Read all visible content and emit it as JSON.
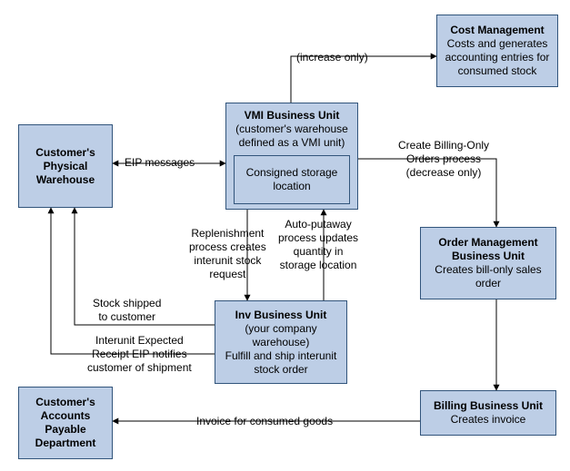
{
  "boxes": {
    "customer_warehouse": {
      "title": "Customer's Physical Warehouse"
    },
    "vmi_bu": {
      "title": "VMI Business Unit",
      "subtitle": "(customer's warehouse defined as a VMI unit)",
      "inner": "Consigned storage location"
    },
    "cost_mgmt": {
      "title": "Cost Management",
      "subtitle": "Costs and generates accounting entries for consumed stock"
    },
    "order_mgmt": {
      "title": "Order Management Business Unit",
      "subtitle": "Creates bill-only sales order"
    },
    "inv_bu": {
      "title": "Inv Business Unit",
      "subtitle1": "(your company warehouse)",
      "subtitle2": "Fulfill and ship interunit stock order"
    },
    "billing_bu": {
      "title": "Billing Business Unit",
      "subtitle": "Creates invoice"
    },
    "ap_dept": {
      "title": "Customer's Accounts Payable Department"
    }
  },
  "labels": {
    "eip_messages": "EIP messages",
    "increase_only": "(increase only)",
    "create_billing_l1": "Create Billing-Only",
    "create_billing_l2": "Orders process",
    "create_billing_l3": "(decrease only)",
    "replenishment_l1": "Replenishment",
    "replenishment_l2": "process creates",
    "replenishment_l3": "interunit stock",
    "replenishment_l4": "request",
    "autoputaway_l1": "Auto-putaway",
    "autoputaway_l2": "process updates",
    "autoputaway_l3": "quantity in",
    "autoputaway_l4": "storage location",
    "stock_shipped_l1": "Stock shipped",
    "stock_shipped_l2": "to customer",
    "interunit_eip_l1": "Interunit Expected",
    "interunit_eip_l2": "Receipt EIP notifies",
    "interunit_eip_l3": "customer of shipment",
    "invoice": "Invoice for consumed goods"
  },
  "chart_data": {
    "type": "flow-diagram",
    "nodes": [
      {
        "id": "customer_warehouse",
        "title": "Customer's Physical Warehouse"
      },
      {
        "id": "vmi_bu",
        "title": "VMI Business Unit",
        "subtitle": "(customer's warehouse defined as a VMI unit)",
        "inner": "Consigned storage location"
      },
      {
        "id": "cost_mgmt",
        "title": "Cost Management",
        "subtitle": "Costs and generates accounting entries for consumed stock"
      },
      {
        "id": "order_mgmt",
        "title": "Order Management Business Unit",
        "subtitle": "Creates bill-only sales order"
      },
      {
        "id": "inv_bu",
        "title": "Inv Business Unit",
        "subtitle": "(your company warehouse) Fulfill and ship interunit stock order"
      },
      {
        "id": "billing_bu",
        "title": "Billing Business Unit",
        "subtitle": "Creates invoice"
      },
      {
        "id": "ap_dept",
        "title": "Customer's Accounts Payable Department"
      }
    ],
    "edges": [
      {
        "from": "customer_warehouse",
        "to": "vmi_bu",
        "label": "EIP messages",
        "bidirectional": true
      },
      {
        "from": "vmi_bu",
        "to": "cost_mgmt",
        "label": "(increase only)"
      },
      {
        "from": "vmi_bu",
        "to": "order_mgmt",
        "label": "Create Billing-Only Orders process (decrease only)"
      },
      {
        "from": "vmi_bu",
        "to": "inv_bu",
        "label": "Replenishment process creates interunit stock request"
      },
      {
        "from": "inv_bu",
        "to": "vmi_bu",
        "label": "Auto-putaway process updates quantity in storage location"
      },
      {
        "from": "inv_bu",
        "to": "customer_warehouse",
        "label": "Stock shipped to customer"
      },
      {
        "from": "inv_bu",
        "to": "customer_warehouse",
        "label": "Interunit Expected Receipt EIP notifies customer of shipment"
      },
      {
        "from": "order_mgmt",
        "to": "billing_bu",
        "label": ""
      },
      {
        "from": "billing_bu",
        "to": "ap_dept",
        "label": "Invoice for consumed goods"
      }
    ]
  }
}
